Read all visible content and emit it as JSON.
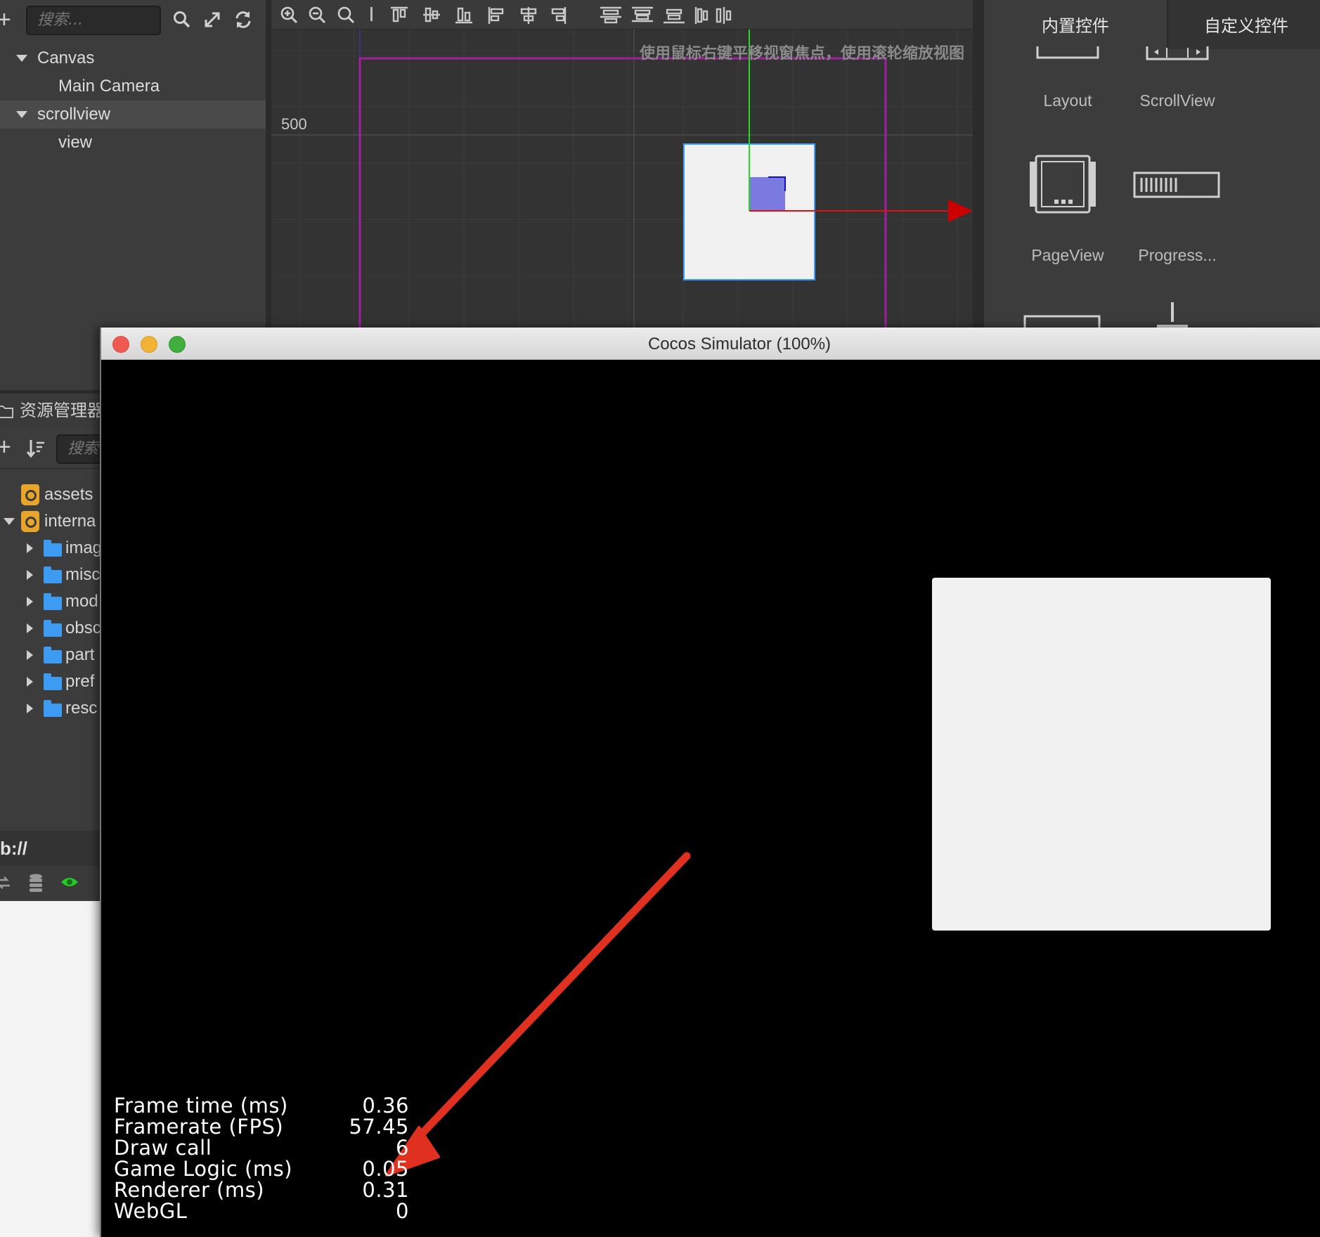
{
  "hierarchy": {
    "search_placeholder": "搜索...",
    "items": [
      {
        "label": "Canvas"
      },
      {
        "label": "Main Camera"
      },
      {
        "label": "scrollview"
      },
      {
        "label": "view"
      }
    ]
  },
  "scene": {
    "hint": "使用鼠标右键平移视窗焦点，使用滚轮缩放视图",
    "ruler_label": "500"
  },
  "widgets": {
    "tabs": [
      "内置控件",
      "自定义控件"
    ],
    "items": [
      {
        "label": "Layout",
        "icon": "layout-icon"
      },
      {
        "label": "ScrollView",
        "icon": "scrollview-icon"
      },
      {
        "label": "PageView",
        "icon": "pageview-icon"
      },
      {
        "label": "Progress...",
        "icon": "progressbar-icon"
      }
    ]
  },
  "assets": {
    "title": "资源管理器",
    "search_placeholder": "搜索",
    "items": [
      {
        "label": "assets"
      },
      {
        "label": "interna"
      },
      {
        "label": "imag"
      },
      {
        "label": "misc"
      },
      {
        "label": "mod"
      },
      {
        "label": "obsc"
      },
      {
        "label": "part"
      },
      {
        "label": "pref"
      },
      {
        "label": "resc"
      }
    ],
    "db_path": "b://"
  },
  "simulator": {
    "title": "Cocos Simulator (100%)",
    "stats": [
      {
        "label": "Frame time (ms)",
        "value": "0.36"
      },
      {
        "label": "Framerate (FPS)",
        "value": "57.45"
      },
      {
        "label": "Draw call",
        "value": "6"
      },
      {
        "label": "Game Logic (ms)",
        "value": "0.05"
      },
      {
        "label": "Renderer (ms)",
        "value": "0.31"
      },
      {
        "label": "WebGL",
        "value": "0"
      }
    ]
  },
  "colors": {
    "selection_purple": "#a020a0",
    "annotation_red": "#e03020",
    "gizmo_green": "#22dd22",
    "gizmo_red": "#dd1111",
    "folder_blue": "#3e9bf2"
  }
}
